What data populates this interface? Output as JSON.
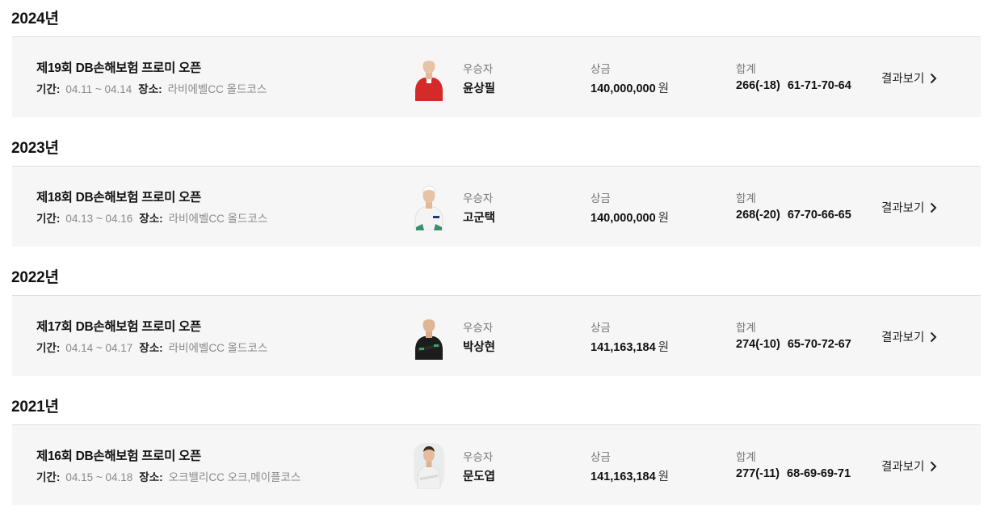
{
  "tournaments": [
    {
      "year": "2024년",
      "title": "제19회 DB손해보험 프로미 오픈",
      "period_label": "기간:",
      "period": "04.11 ~ 04.14",
      "venue_label": "장소:",
      "venue": "라비에벨CC 올드코스",
      "winner_label": "우승자",
      "winner": "윤상필",
      "prize_label": "상금",
      "prize": "140,000,000",
      "prize_unit": "원",
      "total_label": "합계",
      "total": "266(-18)",
      "rounds": "61-71-70-64",
      "result_link": "결과보기",
      "shirt_color": "#d42a2a"
    },
    {
      "year": "2023년",
      "title": "제18회 DB손해보험 프로미 오픈",
      "period_label": "기간:",
      "period": "04.13 ~ 04.16",
      "venue_label": "장소:",
      "venue": "라비에벨CC 올드코스",
      "winner_label": "우승자",
      "winner": "고군택",
      "prize_label": "상금",
      "prize": "140,000,000",
      "prize_unit": "원",
      "total_label": "합계",
      "total": "268(-20)",
      "rounds": "67-70-66-65",
      "result_link": "결과보기",
      "shirt_color": "#f4f4f4"
    },
    {
      "year": "2022년",
      "title": "제17회 DB손해보험 프로미 오픈",
      "period_label": "기간:",
      "period": "04.14 ~ 04.17",
      "venue_label": "장소:",
      "venue": "라비에벨CC 올드코스",
      "winner_label": "우승자",
      "winner": "박상현",
      "prize_label": "상금",
      "prize": "141,163,184",
      "prize_unit": "원",
      "total_label": "합계",
      "total": "274(-10)",
      "rounds": "65-70-72-67",
      "result_link": "결과보기",
      "shirt_color": "#1d1d1d"
    },
    {
      "year": "2021년",
      "title": "제16회 DB손해보험 프로미 오픈",
      "period_label": "기간:",
      "period": "04.15 ~ 04.18",
      "venue_label": "장소:",
      "venue": "오크밸리CC 오크,메이플코스",
      "winner_label": "우승자",
      "winner": "문도엽",
      "prize_label": "상금",
      "prize": "141,163,184",
      "prize_unit": "원",
      "total_label": "합계",
      "total": "277(-11)",
      "rounds": "68-69-69-71",
      "result_link": "결과보기",
      "shirt_color": "#f0f0f0"
    }
  ]
}
